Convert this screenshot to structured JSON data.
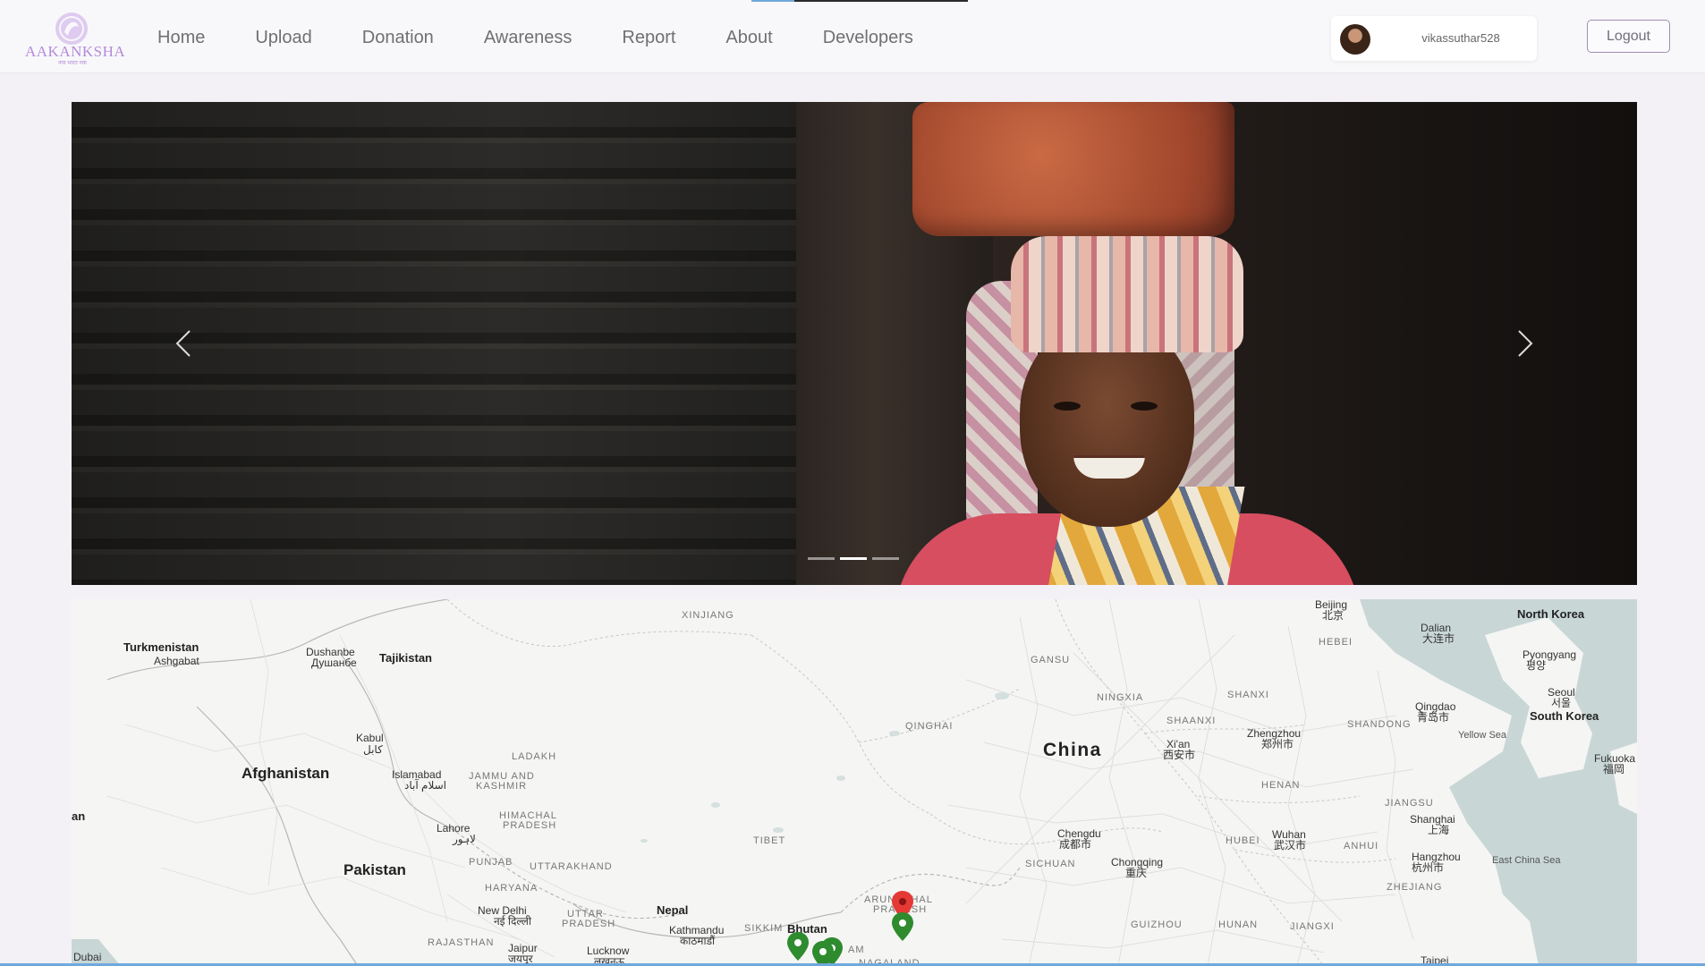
{
  "app": {
    "logo_text": "AAKANKSHA",
    "logo_tagline": "नया भारत नया",
    "brand_color": "#b48ad8"
  },
  "nav": {
    "items": [
      {
        "label": "Home"
      },
      {
        "label": "Upload"
      },
      {
        "label": "Donation"
      },
      {
        "label": "Awareness"
      },
      {
        "label": "Report"
      },
      {
        "label": "About"
      },
      {
        "label": "Developers"
      }
    ]
  },
  "user": {
    "username": "vikassuthar528",
    "logout_label": "Logout"
  },
  "carousel": {
    "slide_count": 3,
    "active_index": 1,
    "prev_icon": "chevron-left-icon",
    "next_icon": "chevron-right-icon"
  },
  "map": {
    "labels": {
      "turkmenistan": "Turkmenistan",
      "ashgabat": "Ashgabat",
      "dushanbe": "Dushanbe",
      "dushanbe_local": "Душанбе",
      "tajikistan": "Tajikistan",
      "kabul": "Kabul",
      "kabul_local": "کابل",
      "afghanistan": "Afghanistan",
      "islamabad": "Islamabad",
      "islamabad_local": "اسلام آباد",
      "jammu_kashmir_1": "JAMMU AND",
      "jammu_kashmir_2": "KASHMIR",
      "ladakh": "LADAKH",
      "himachal_1": "HIMACHAL",
      "himachal_2": "PRADESH",
      "lahore": "Lahore",
      "lahore_local": "لاہور",
      "pakistan": "Pakistan",
      "punjab": "PUNJAB",
      "uttarakhand": "UTTARAKHAND",
      "haryana": "HARYANA",
      "new_delhi": "New Delhi",
      "new_delhi_local": "नई दिल्ली",
      "uttar_1": "UTTAR",
      "uttar_2": "PRADESH",
      "rajasthan": "RAJASTHAN",
      "jaipur": "Jaipur",
      "jaipur_local": "जयपुर",
      "lucknow": "Lucknow",
      "lucknow_local": "लखनऊ",
      "nepal": "Nepal",
      "kathmandu": "Kathmandu",
      "kathmandu_local": "काठमाडौं",
      "sikkim": "SIKKIM",
      "bhutan": "Bhutan",
      "assam": "AM",
      "nagaland": "NAGALAND",
      "arunachal_1": "ARUNACHAL",
      "arunachal_2": "PRADESH",
      "xinjiang": "XINJIANG",
      "tibet": "TIBET",
      "qinghai": "QINGHAI",
      "gansu": "GANSU",
      "ningxia": "NINGXIA",
      "china": "China",
      "shanxi": "SHANXI",
      "shaanxi": "SHAANXI",
      "xian": "Xi'an",
      "xian_local": "西安市",
      "zhengzhou": "Zhengzhou",
      "zhengzhou_local": "郑州市",
      "henan": "HENAN",
      "chengdu": "Chengdu",
      "chengdu_local": "成都市",
      "sichuan": "SICHUAN",
      "chongqing": "Chongqing",
      "chongqing_local": "重庆",
      "hubei": "HUBEI",
      "wuhan": "Wuhan",
      "wuhan_local": "武汉市",
      "anhui": "ANHUI",
      "guizhou": "GUIZHOU",
      "hunan": "HUNAN",
      "jiangxi": "JIANGXI",
      "beijing": "Beijing",
      "beijing_local": "北京",
      "hebei": "HEBEI",
      "dalian": "Dalian",
      "dalian_local": "大连市",
      "shandong": "SHANDONG",
      "qingdao": "Qingdao",
      "qingdao_local": "青岛市",
      "jiangsu": "JIANGSU",
      "shanghai": "Shanghai",
      "shanghai_local": "上海",
      "hangzhou": "Hangzhou",
      "hangzhou_local": "杭州市",
      "zhejiang": "ZHEJIANG",
      "east_china_sea": "East China Sea",
      "yellow_sea": "Yellow Sea",
      "north_korea": "North Korea",
      "pyongyang": "Pyongyang",
      "pyongyang_local": "평양",
      "seoul": "Seoul",
      "seoul_local": "서울",
      "south_korea": "South Korea",
      "fukuoka": "Fukuoka",
      "fukuoka_local": "福岡",
      "taipei": "Taipei",
      "dubai": "Dubai",
      "partial_an": "an"
    },
    "markers": [
      {
        "color": "#e53935",
        "kind": "report-marker"
      },
      {
        "color": "#2e8b2e",
        "kind": "report-marker"
      },
      {
        "color": "#2e8b2e",
        "kind": "report-marker"
      },
      {
        "color": "#2e8b2e",
        "kind": "report-marker"
      },
      {
        "color": "#2e8b2e",
        "kind": "report-marker"
      }
    ],
    "water_color": "#c8d7d6",
    "land_color": "#f5f5f4"
  }
}
